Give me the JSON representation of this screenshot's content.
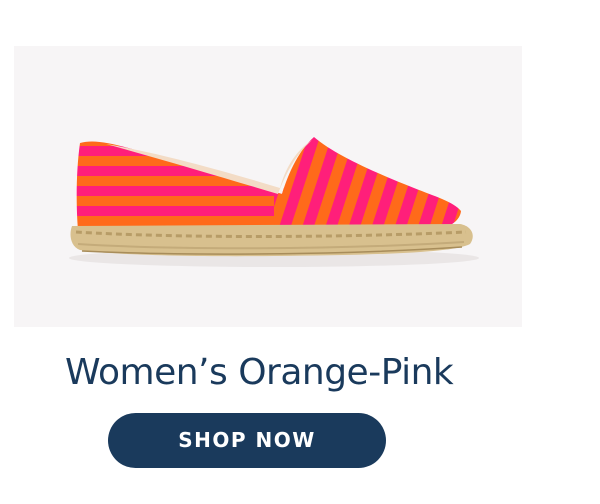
{
  "product": {
    "title": "Women’s Orange-Pink",
    "image_alt": "striped espadrille shoe",
    "colors": {
      "orange": "#ff6a1a",
      "pink": "#ff1f7a",
      "jute": "#d8c08e",
      "background": "#f7f5f6"
    }
  },
  "cta": {
    "label": "SHOP NOW",
    "background": "#1a3a5c",
    "text_color": "#ffffff"
  }
}
